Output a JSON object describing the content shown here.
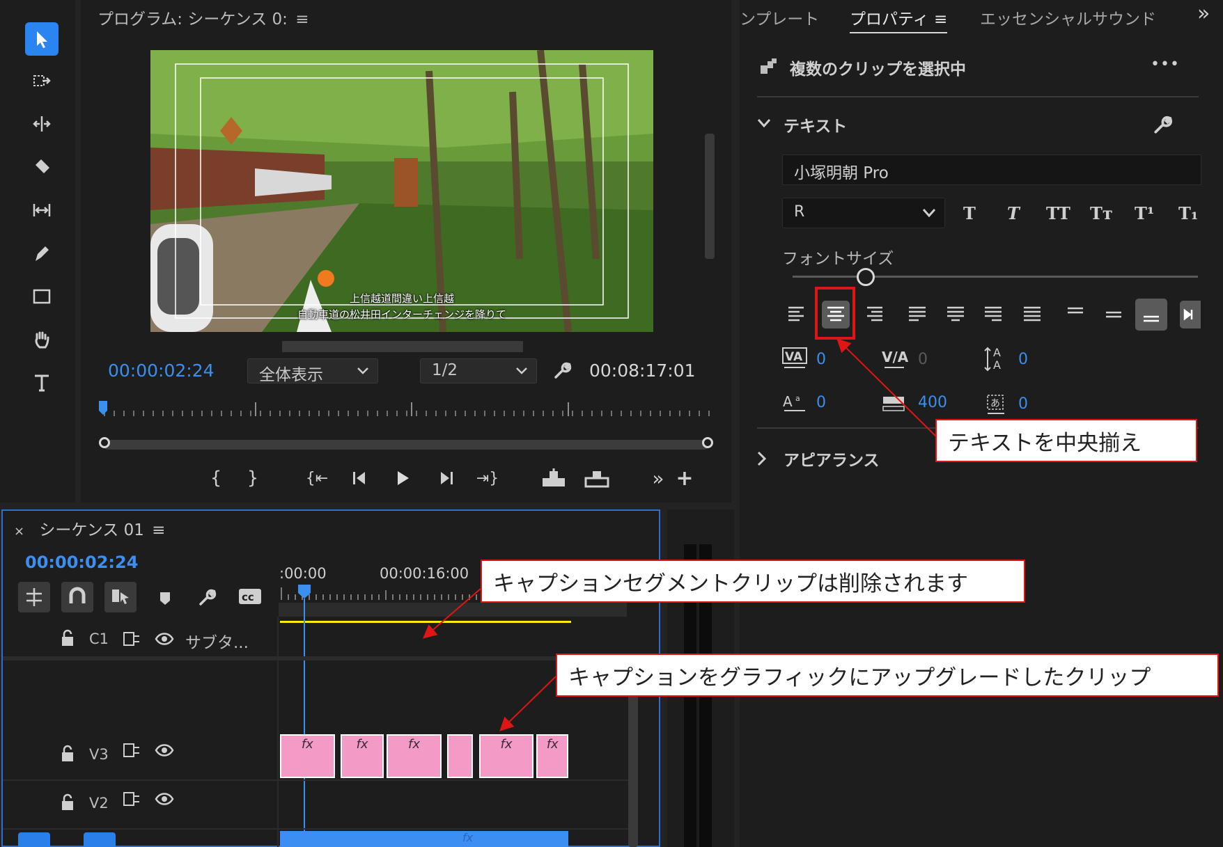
{
  "tools": [
    "selection-tool",
    "track-select-tool",
    "ripple-edit-tool",
    "razor-tool",
    "slip-tool",
    "pen-tool",
    "rectangle-tool",
    "hand-tool",
    "type-tool"
  ],
  "program": {
    "title": "プログラム: シーケンス 0:",
    "menu_glyph": "≡",
    "subtitle_line1": "上信越道間違い上信越",
    "subtitle_line2": "自動車道の松井田インターチェンジを降りて",
    "timecode": "00:00:02:24",
    "zoom_select": "全体表示",
    "resolution_select": "1/2",
    "duration": "00:08:17:01",
    "transport": [
      "{",
      "}",
      "{⇤",
      "◀|",
      "▶",
      "|▶",
      "⇥}",
      "⊞",
      "⊟",
      "»",
      "+"
    ]
  },
  "right_tabs": {
    "items": [
      "ンプレート",
      "プロパティ",
      "エッセンシャルサウンド"
    ],
    "active_index": 1,
    "menu_glyph": "≡",
    "overflow": "»"
  },
  "properties": {
    "selection_header": "複数のクリップを選択中",
    "more": "•••",
    "text_section": "テキスト",
    "font_name": "小塚明朝 Pro",
    "font_style": "R",
    "format_buttons": [
      "T",
      "T",
      "TT",
      "Tт",
      "T¹",
      "T₁"
    ],
    "font_size_label": "フォントサイズ",
    "font_size_fraction": 0.18,
    "metrics": {
      "kerning": "0",
      "tracking": "0",
      "leading": "0",
      "baseline_shift": "0",
      "tsume": "400",
      "ruby": "0"
    },
    "appearance_section": "アピアランス"
  },
  "timeline": {
    "close": "×",
    "title": "シーケンス 01",
    "menu_glyph": "≡",
    "timecode": "00:00:02:24",
    "ruler_labels": [
      ":00:00",
      "00:00:16:00"
    ],
    "tracks": [
      {
        "lock": "lock-icon",
        "name": "C1",
        "label": "サブタ..."
      },
      {
        "lock": "lock-icon",
        "name": "V3",
        "label": ""
      },
      {
        "lock": "lock-icon",
        "name": "V2",
        "label": ""
      }
    ],
    "fx_label": "fx",
    "v3_clips": [
      {
        "start": 0.0,
        "end": 0.19,
        "fx": true
      },
      {
        "start": 0.21,
        "end": 0.36,
        "fx": true
      },
      {
        "start": 0.37,
        "end": 0.56,
        "fx": true
      },
      {
        "start": 0.58,
        "end": 0.67,
        "fx": false
      },
      {
        "start": 0.69,
        "end": 0.88,
        "fx": true
      },
      {
        "start": 0.89,
        "end": 1.0,
        "fx": true
      }
    ]
  },
  "callouts": {
    "center_text": "テキストを中央揃え",
    "caption_removed": "キャプションセグメントクリップは削除されます",
    "caption_upgraded": "キャプションをグラフィックにアップグレードしたクリップ"
  },
  "colors": {
    "accent_blue": "#3b8ff0",
    "clip_pink": "#f39ac7",
    "caption_yellow": "#ffee00",
    "callout_red": "#e01515"
  }
}
